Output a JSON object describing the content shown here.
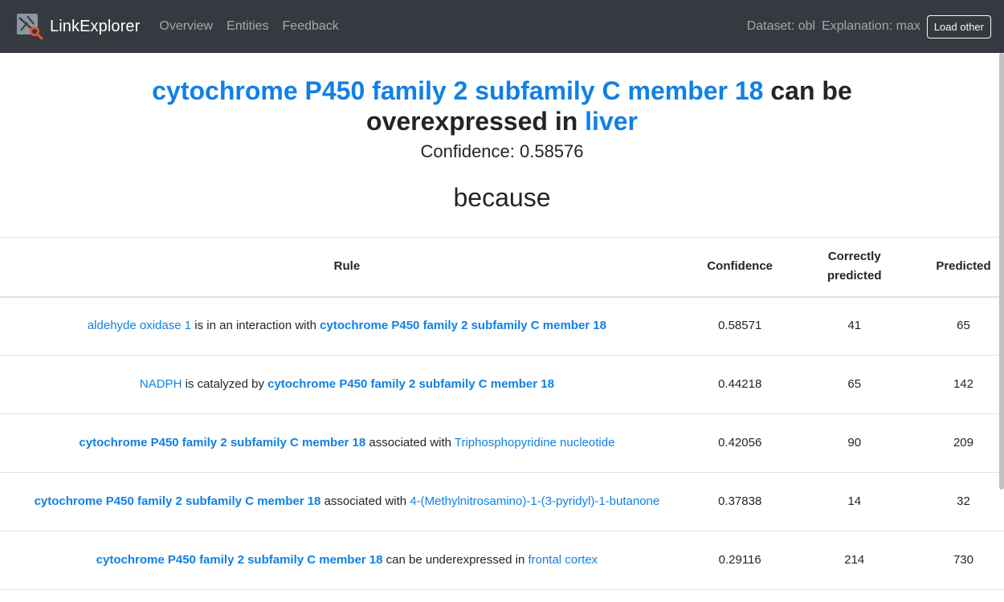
{
  "navbar": {
    "brand": "LinkExplorer",
    "links": [
      "Overview",
      "Entities",
      "Feedback"
    ],
    "dataset": "Dataset: obl",
    "explanation": "Explanation: max",
    "load_button": "Load other"
  },
  "prediction": {
    "subject": "cytochrome P450 family 2 subfamily C member 18",
    "relation": " can be overexpressed in ",
    "object": "liver",
    "confidence_label": "Confidence: 0.58576",
    "because": "because"
  },
  "table": {
    "headers": {
      "rule": "Rule",
      "confidence": "Confidence",
      "correct_line1": "Correctly",
      "correct_line2": "predicted",
      "predicted": "Predicted"
    },
    "rows": [
      {
        "p1": "aldehyde oxidase 1",
        "p1_bold": false,
        "mid": " is in an interaction with ",
        "p2": "cytochrome P450 family 2 subfamily C member 18",
        "p2_bold": true,
        "confidence": "0.58571",
        "correct": "41",
        "predicted": "65"
      },
      {
        "p1": "NADPH",
        "p1_bold": false,
        "mid": " is catalyzed by ",
        "p2": "cytochrome P450 family 2 subfamily C member 18",
        "p2_bold": true,
        "confidence": "0.44218",
        "correct": "65",
        "predicted": "142"
      },
      {
        "p1": "cytochrome P450 family 2 subfamily C member 18",
        "p1_bold": true,
        "mid": " associated with ",
        "p2": "Triphosphopyridine nucleotide",
        "p2_bold": false,
        "confidence": "0.42056",
        "correct": "90",
        "predicted": "209"
      },
      {
        "p1": "cytochrome P450 family 2 subfamily C member 18",
        "p1_bold": true,
        "mid": " associated with ",
        "p2": "4-(Methylnitrosamino)-1-(3-pyridyl)-1-butanone",
        "p2_bold": false,
        "confidence": "0.37838",
        "correct": "14",
        "predicted": "32"
      },
      {
        "p1": "cytochrome P450 family 2 subfamily C member 18",
        "p1_bold": true,
        "mid": " can be underexpressed in ",
        "p2": "frontal cortex",
        "p2_bold": false,
        "confidence": "0.29116",
        "correct": "214",
        "predicted": "730"
      }
    ]
  },
  "colors": {
    "navbar_bg": "#343a40",
    "link": "#1180e6",
    "logo_accent": "#e8542c"
  },
  "icons": {
    "logo": "link-explorer-logo-icon"
  }
}
